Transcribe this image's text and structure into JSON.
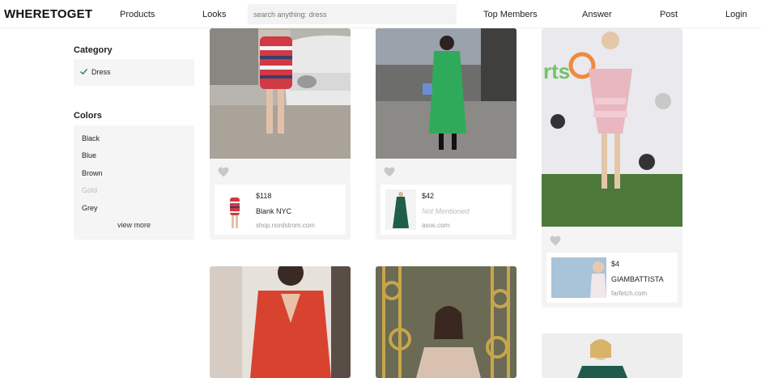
{
  "nav": {
    "logo": "WHERETOGET",
    "links": [
      "Products",
      "Looks",
      "Top Members",
      "Answer",
      "Post",
      "Login"
    ],
    "search_placeholder": "search anything: dress"
  },
  "sidebar": {
    "category_title": "Category",
    "category_selected": "Dress",
    "colors_title": "Colors",
    "colors": [
      "Black",
      "Blue",
      "Brown",
      "Gold",
      "Grey"
    ],
    "view_more": "view more"
  },
  "cards": [
    {
      "price": "$118",
      "brand": "Blank NYC",
      "store": "shop.nordstrom.com"
    },
    {
      "price": "$42",
      "brand": "Not Mentioned",
      "store": "asos.com"
    },
    {
      "price": "$4",
      "brand": "GIAMBATTISTA",
      "store": "farfetch.com"
    }
  ],
  "colors": {
    "accent_check": "#2d8a4e",
    "heart": "#c8c8c8",
    "card_bg": "#f4f4f4"
  },
  "icons": [
    "check-icon",
    "heart-icon"
  ]
}
